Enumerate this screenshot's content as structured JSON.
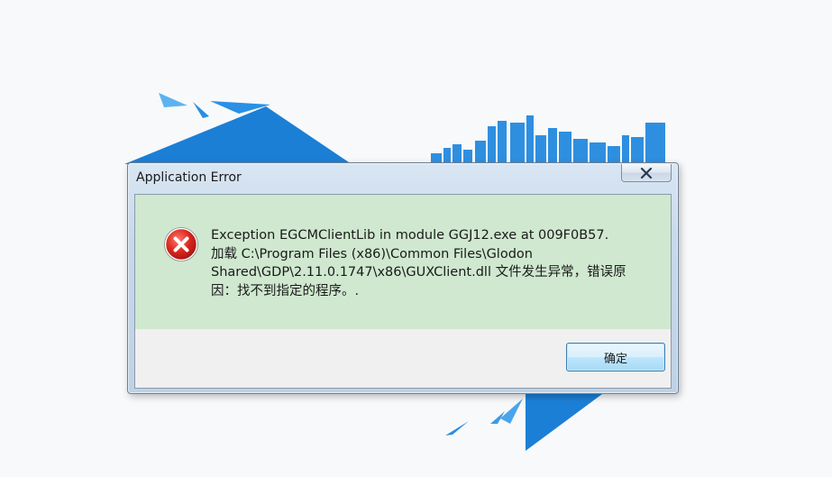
{
  "dialog": {
    "title": "Application Error",
    "close_icon": "close-x-icon",
    "error_icon": "error-circle-x-icon",
    "message_lines": [
      "Exception EGCMClientLib in module GGJ12.exe at 009F0B57.",
      "加载 C:\\Program Files (x86)\\Common Files\\Glodon",
      "Shared\\GDP\\2.11.0.1747\\x86\\GUXClient.dll 文件发生异常，错误原",
      "因：找不到指定的程序。."
    ],
    "ok_label": "确定"
  },
  "colors": {
    "accent_blue": "#1e88e5",
    "content_bg": "#cfe8cf",
    "error_red": "#d32f2f"
  }
}
